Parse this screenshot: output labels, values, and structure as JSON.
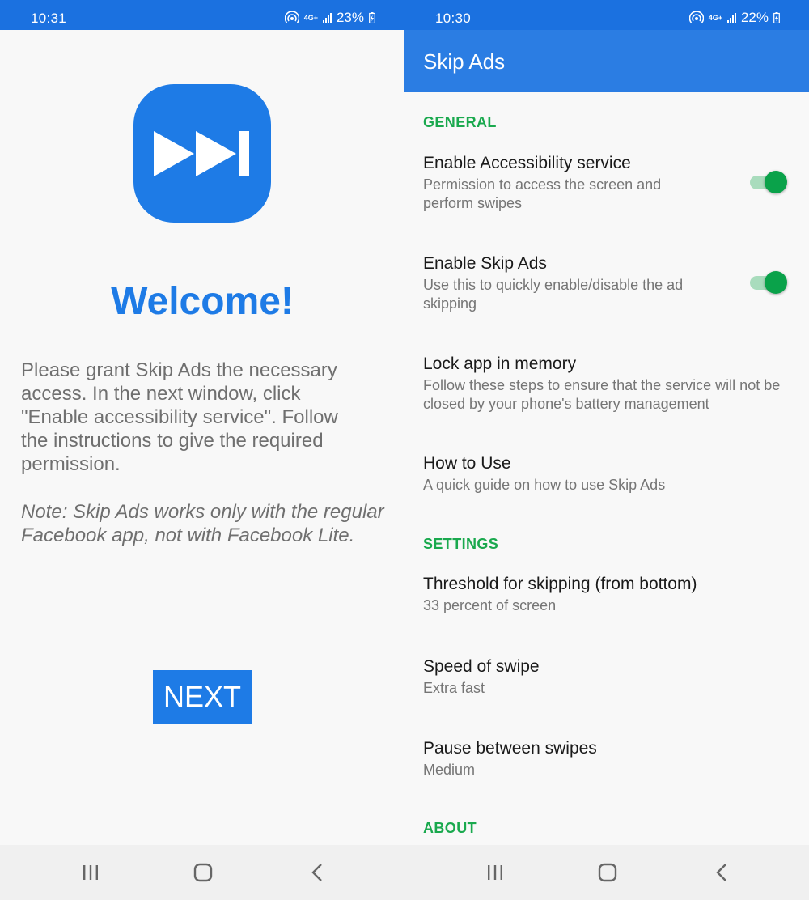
{
  "left_screen": {
    "status_bar": {
      "time": "10:31",
      "network": "4G+",
      "battery": "23%"
    },
    "welcome_title": "Welcome!",
    "grant_text": "Please grant Skip Ads the necessary access. In the next window, click \"Enable accessibility service\". Follow the instructions to give the required permission.",
    "note_text": "Note: Skip Ads works only with the regular Facebook app, not with Facebook Lite.",
    "next_label": "NEXT"
  },
  "right_screen": {
    "status_bar": {
      "time": "10:30",
      "network": "4G+",
      "battery": "22%"
    },
    "app_title": "Skip Ads",
    "sections": {
      "general": "GENERAL",
      "settings": "SETTINGS",
      "about": "ABOUT"
    },
    "prefs": {
      "accessibility": {
        "title": "Enable Accessibility service",
        "summary": "Permission to access the screen and perform swipes",
        "enabled": true
      },
      "skip_ads": {
        "title": "Enable Skip Ads",
        "summary": "Use this to quickly enable/disable the ad skipping",
        "enabled": true
      },
      "lock_memory": {
        "title": "Lock app in memory",
        "summary": "Follow these steps to ensure that the service will not be closed by your phone's battery management"
      },
      "how_to": {
        "title": "How to Use",
        "summary": "A quick guide on how to use Skip Ads"
      },
      "threshold": {
        "title": "Threshold for skipping (from bottom)",
        "summary": "33 percent of screen"
      },
      "speed": {
        "title": "Speed of swipe",
        "summary": "Extra fast"
      },
      "pause": {
        "title": "Pause between swipes",
        "summary": "Medium"
      }
    }
  },
  "colors": {
    "primary_blue": "#1e7be6",
    "section_green": "#1aa94e",
    "switch_on": "#0aa24a"
  },
  "icons": {
    "status": [
      "hotspot-icon",
      "signal-icon",
      "battery-charging-icon"
    ],
    "nav": [
      "recent-apps-icon",
      "home-icon",
      "back-icon"
    ],
    "logo": "skip-forward-icon"
  }
}
